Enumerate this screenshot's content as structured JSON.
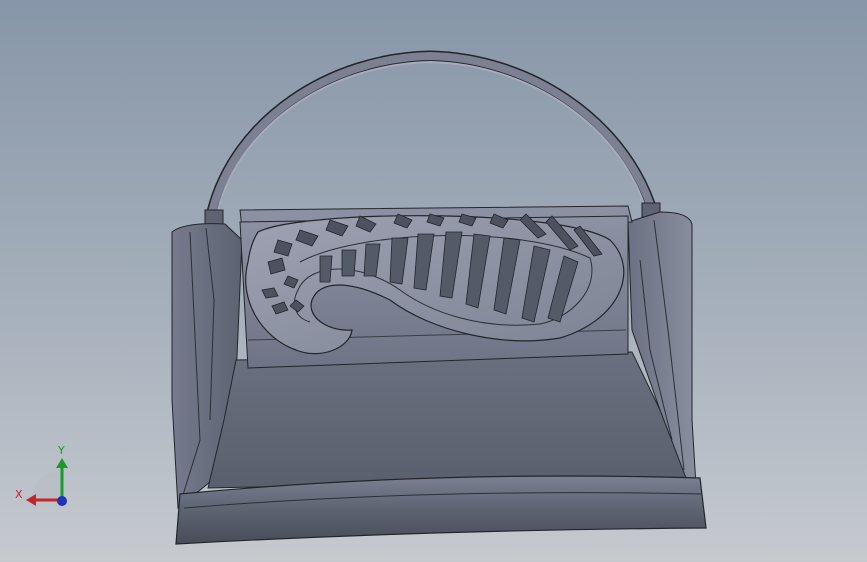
{
  "colors": {
    "background_top": "#8796a8",
    "background_bottom": "#c6cacf",
    "model_base": "#656b79",
    "model_light": "#8b90a2",
    "model_dark": "#3f4350",
    "edge": "#23252c",
    "axis_x": "#c0262b",
    "axis_y": "#1b9a2e",
    "axis_z": "#2233b5"
  },
  "triad": {
    "x_label": "X",
    "y_label": "Y"
  },
  "icons": [
    "axis-triad-icon"
  ]
}
